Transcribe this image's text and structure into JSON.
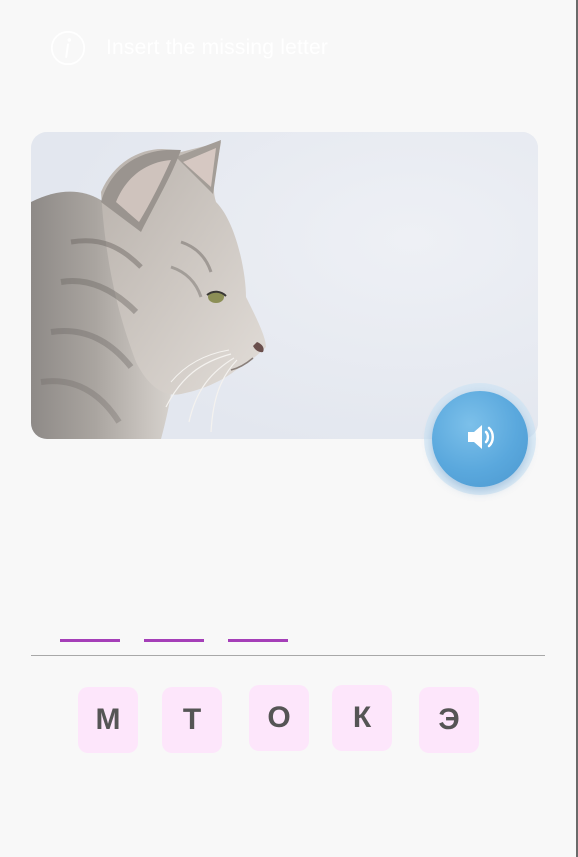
{
  "header": {
    "info_icon": "info-icon",
    "instruction": "Insert the missing letter"
  },
  "picture": {
    "subject": "cat-photo"
  },
  "sound_button": {
    "icon": "speaker-icon",
    "color": "#5aa8dd"
  },
  "answer": {
    "slots": [
      "",
      "",
      ""
    ],
    "slot_color": "#a53fb8"
  },
  "letters": [
    "М",
    "Т",
    "О",
    "К",
    "Э"
  ],
  "tile_color": "#fde6fb"
}
